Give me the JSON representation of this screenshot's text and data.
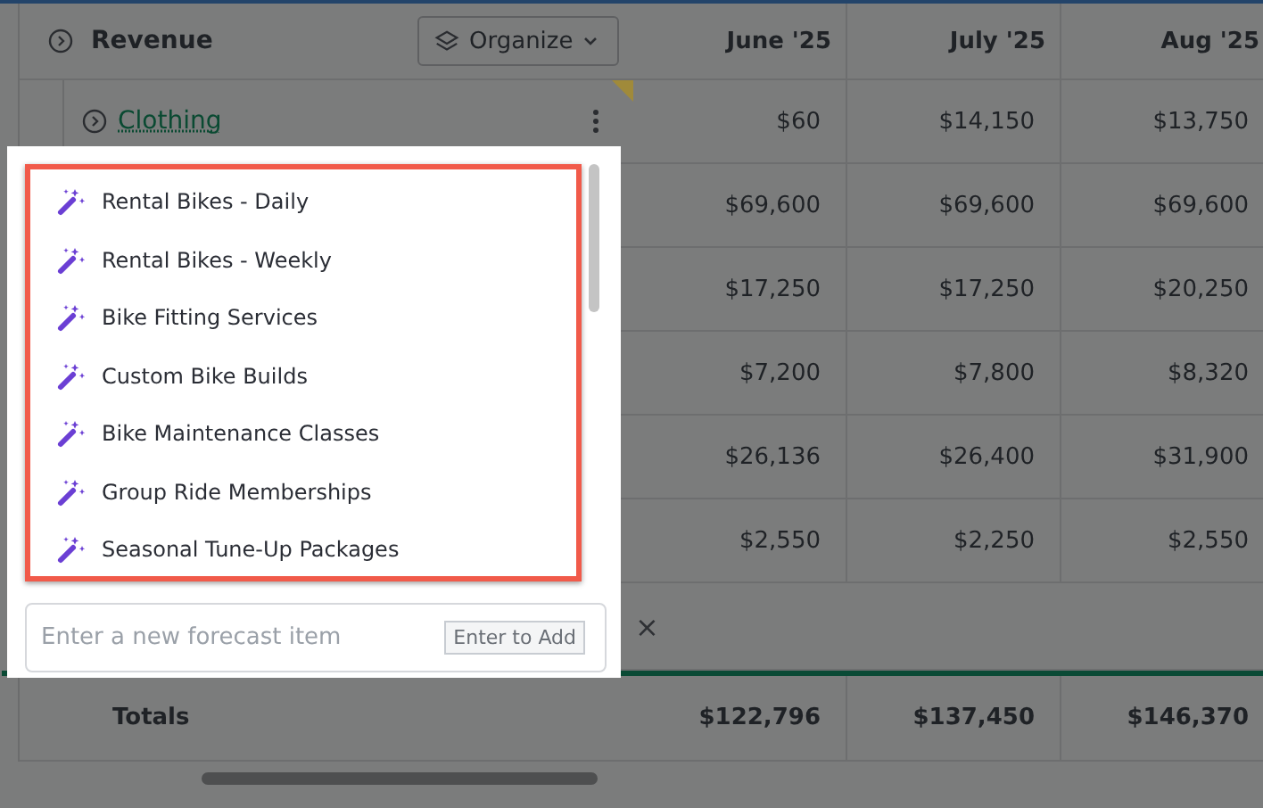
{
  "table": {
    "title": "Revenue",
    "organize_button": "Organize",
    "columns": [
      "June '25",
      "July '25",
      "Aug '25"
    ],
    "rows": [
      {
        "name": "Clothing",
        "values": [
          "$60",
          "$14,150",
          "$13,750"
        ]
      },
      {
        "values": [
          "$69,600",
          "$69,600",
          "$69,600"
        ]
      },
      {
        "values": [
          "$17,250",
          "$17,250",
          "$20,250"
        ]
      },
      {
        "values": [
          "$7,200",
          "$7,800",
          "$8,320"
        ]
      },
      {
        "values": [
          "$26,136",
          "$26,400",
          "$31,900"
        ]
      },
      {
        "values": [
          "$2,550",
          "$2,250",
          "$2,550"
        ]
      }
    ],
    "close_symbol": "×",
    "totals": {
      "label": "Totals",
      "values": [
        "$122,796",
        "$137,450",
        "$146,370"
      ]
    }
  },
  "popup": {
    "suggestions": [
      "Rental Bikes - Daily",
      "Rental Bikes - Weekly",
      "Bike Fitting Services",
      "Custom Bike Builds",
      "Bike Maintenance Classes",
      "Group Ride Memberships",
      "Seasonal Tune-Up Packages"
    ],
    "input": {
      "placeholder": "Enter a new forecast item",
      "hint": "Enter to Add"
    }
  }
}
